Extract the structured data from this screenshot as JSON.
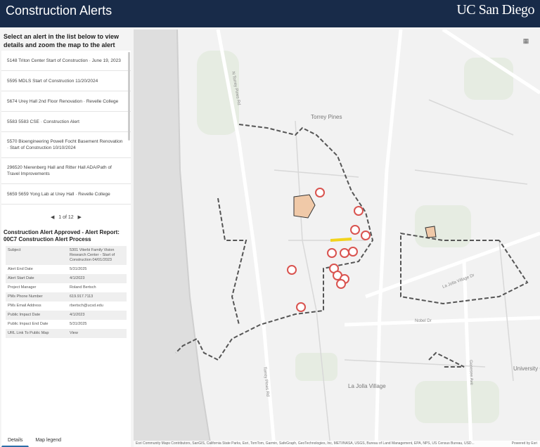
{
  "header": {
    "title": "Construction Alerts",
    "logo": "UC San Diego"
  },
  "intro": "Select an alert in the list below to view details and zoom the map to the alert location.",
  "alerts": [
    "5148 Triton Center Start of Construction · June 19, 2023",
    "5595 MDLS Start of Construction 11/20/2024",
    "5674 Urey Hall 2nd Floor Renovation · Revelle College",
    "5583 5583 CSE · Construction Alert",
    "5570 Bioengineering Powell Focht Basement Renovation · Start of Construction 10/10/2024",
    "296520 Nierenberg Hall and Ritter Hall ADA/Path of Travel Improvements",
    "5659 5659 Yong Lab at Urey Hall · Revelle College"
  ],
  "pager": {
    "text": "1 of 12",
    "prev": "◀",
    "next": "▶"
  },
  "detail": {
    "title": "Construction Alert Approved - Alert Report: 00C7 Construction Alert Process",
    "rows": [
      {
        "k": "Subject",
        "v": "5301 Viterbi Family Vision Research Center - Start of Construction 04/01/2023"
      },
      {
        "k": "Alert End Date",
        "v": "5/31/2025"
      },
      {
        "k": "Alert Start Date",
        "v": "4/1/2023"
      },
      {
        "k": "Project Manager",
        "v": "Roland Bertsch"
      },
      {
        "k": "PMs Phone Number",
        "v": "619.917.7113"
      },
      {
        "k": "PMs Email Address",
        "v": "rbertsch@ucsd.edu"
      },
      {
        "k": "Public Impact Date",
        "v": "4/1/2023"
      },
      {
        "k": "Public Impact End Date",
        "v": "5/31/2025"
      },
      {
        "k": "URL Link To Public Map",
        "v": "View"
      }
    ]
  },
  "tabs": [
    "Details",
    "Map legend"
  ],
  "map": {
    "labels": [
      "Torrey Pines",
      "La Jolla Village",
      "University City",
      "Nobel Dr",
      "La Jolla Village Dr",
      "Genesee Ave",
      "Torrey Pines Rd",
      "N Torrey Pines Rd"
    ],
    "attribution": "Esri Community Maps Contributors, SanGIS, California State Parks, Esri, TomTom, Garmin, SafeGraph, GeoTechnologies, Inc, METI/NASA, USGS, Bureau of Land Management, EPA, NPS, US Census Bureau, USD...",
    "powered": "Powered by Esri"
  },
  "colors": {
    "header": "#182b49",
    "alert": "#d9534f",
    "boundary": "#555555"
  }
}
